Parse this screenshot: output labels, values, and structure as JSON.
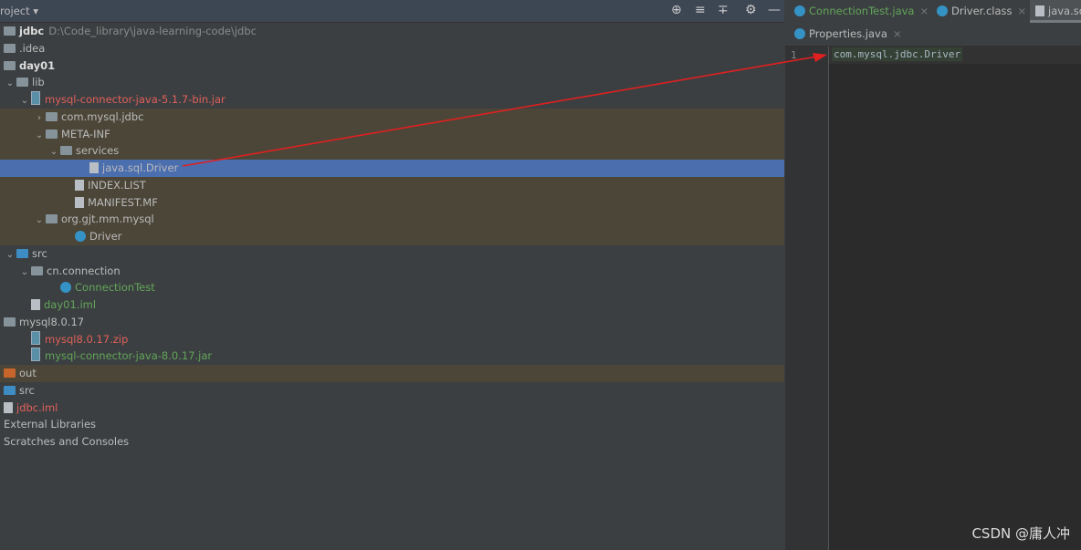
{
  "panel": {
    "title": "roject ▾"
  },
  "tree": [
    {
      "label": "jdbc",
      "extra": "D:\\Code_library\\java-learning-code\\jdbc",
      "indent": 0,
      "icon": "module",
      "arrow": "",
      "cls": "b"
    },
    {
      "label": ".idea",
      "indent": 0,
      "icon": "folder",
      "arrow": ""
    },
    {
      "label": "day01",
      "indent": 0,
      "icon": "module",
      "arrow": "",
      "cls": "b"
    },
    {
      "label": "lib",
      "indent": 0,
      "icon": "folder",
      "arrow": "v"
    },
    {
      "label": "mysql-connector-java-5.1.7-bin.jar",
      "indent": 1,
      "icon": "jar",
      "arrow": "v",
      "cls": "red"
    },
    {
      "label": "com.mysql.jdbc",
      "indent": 2,
      "icon": "folder",
      "arrow": ">",
      "hl": true
    },
    {
      "label": "META-INF",
      "indent": 2,
      "icon": "folder",
      "arrow": "v",
      "hl": true
    },
    {
      "label": "services",
      "indent": 3,
      "icon": "folder",
      "arrow": "v",
      "hl": true
    },
    {
      "label": "java.sql.Driver",
      "indent": 5,
      "icon": "file",
      "arrow": "",
      "sel": true
    },
    {
      "label": "INDEX.LIST",
      "indent": 4,
      "icon": "file",
      "arrow": "",
      "hl": true
    },
    {
      "label": "MANIFEST.MF",
      "indent": 4,
      "icon": "file",
      "arrow": "",
      "hl": true
    },
    {
      "label": "org.gjt.mm.mysql",
      "indent": 2,
      "icon": "folder",
      "arrow": "v",
      "hl": true
    },
    {
      "label": "Driver",
      "indent": 4,
      "icon": "class",
      "arrow": "",
      "hl": true
    },
    {
      "label": "src",
      "indent": 0,
      "icon": "folder-blue",
      "arrow": "v"
    },
    {
      "label": "cn.connection",
      "indent": 1,
      "icon": "folder",
      "arrow": "v"
    },
    {
      "label": "ConnectionTest",
      "indent": 3,
      "icon": "class",
      "arrow": "",
      "cls": "green"
    },
    {
      "label": "day01.iml",
      "indent": 1,
      "icon": "file",
      "arrow": "",
      "cls": "green"
    },
    {
      "label": "mysql8.0.17",
      "indent": 0,
      "icon": "folder",
      "arrow": ""
    },
    {
      "label": "mysql8.0.17.zip",
      "indent": 1,
      "icon": "jar",
      "arrow": "",
      "cls": "red"
    },
    {
      "label": "mysql-connector-java-8.0.17.jar",
      "indent": 1,
      "icon": "jar",
      "arrow": "",
      "cls": "green"
    },
    {
      "label": "out",
      "indent": 0,
      "icon": "folder-orange",
      "arrow": "",
      "hl": true
    },
    {
      "label": "src",
      "indent": 0,
      "icon": "folder-blue",
      "arrow": ""
    },
    {
      "label": "jdbc.iml",
      "indent": 0,
      "icon": "file",
      "arrow": "",
      "cls": "red"
    },
    {
      "label": "External Libraries",
      "indent": 0,
      "icon": "",
      "arrow": ""
    },
    {
      "label": "Scratches and Consoles",
      "indent": 0,
      "icon": "",
      "arrow": ""
    }
  ],
  "editor": {
    "tabs": [
      {
        "label": "ConnectionTest.java",
        "color": "#62a65a"
      },
      {
        "label": "Driver.class",
        "color": "#bbbbbb"
      },
      {
        "label": "java.sql.Driver",
        "color": "#bbbbbb"
      }
    ],
    "tabs2": [
      {
        "label": "Properties.java"
      }
    ],
    "line_number": "1",
    "code": "com.mysql.jdbc.Driver"
  },
  "watermark": "CSDN @庸人冲"
}
